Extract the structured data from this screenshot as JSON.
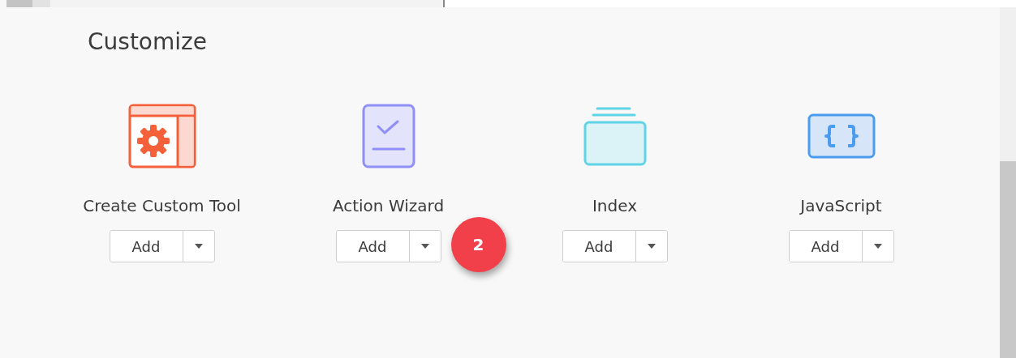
{
  "section_title": "Customize",
  "tools": [
    {
      "kind": "gear",
      "label": "Create Custom Tool",
      "button": "Add"
    },
    {
      "kind": "checklist",
      "label": "Action Wizard",
      "button": "Add",
      "badge": "2"
    },
    {
      "kind": "stack",
      "label": "Index",
      "button": "Add"
    },
    {
      "kind": "braces",
      "label": "JavaScript",
      "button": "Add"
    }
  ]
}
